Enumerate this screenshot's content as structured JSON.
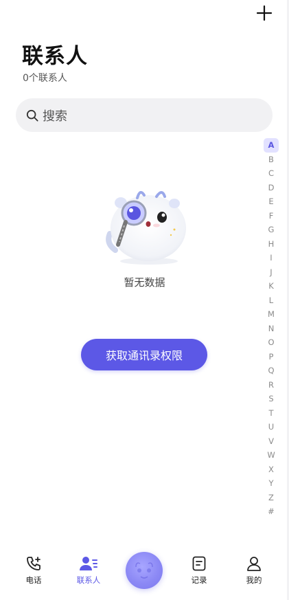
{
  "header": {
    "title": "联系人",
    "count_text": "0个联系人"
  },
  "search": {
    "placeholder": "搜索"
  },
  "index_letters": [
    "A",
    "B",
    "C",
    "D",
    "E",
    "F",
    "G",
    "H",
    "I",
    "J",
    "K",
    "L",
    "M",
    "N",
    "O",
    "P",
    "Q",
    "R",
    "S",
    "T",
    "U",
    "V",
    "W",
    "X",
    "Y",
    "Z",
    "#"
  ],
  "active_index": "A",
  "empty_state": {
    "text": "暂无数据",
    "button_label": "获取通讯录权限"
  },
  "tabbar": {
    "items": [
      {
        "label": "电话",
        "icon": "phone-icon"
      },
      {
        "label": "联系人",
        "icon": "contacts-icon"
      },
      {
        "label": "",
        "icon": "mascot-center-icon"
      },
      {
        "label": "记录",
        "icon": "records-icon"
      },
      {
        "label": "我的",
        "icon": "profile-icon"
      }
    ],
    "active": "联系人"
  },
  "colors": {
    "accent": "#5c58e6",
    "search_bg": "#f1f1f3",
    "index_active_bg": "#e2e1ff"
  }
}
